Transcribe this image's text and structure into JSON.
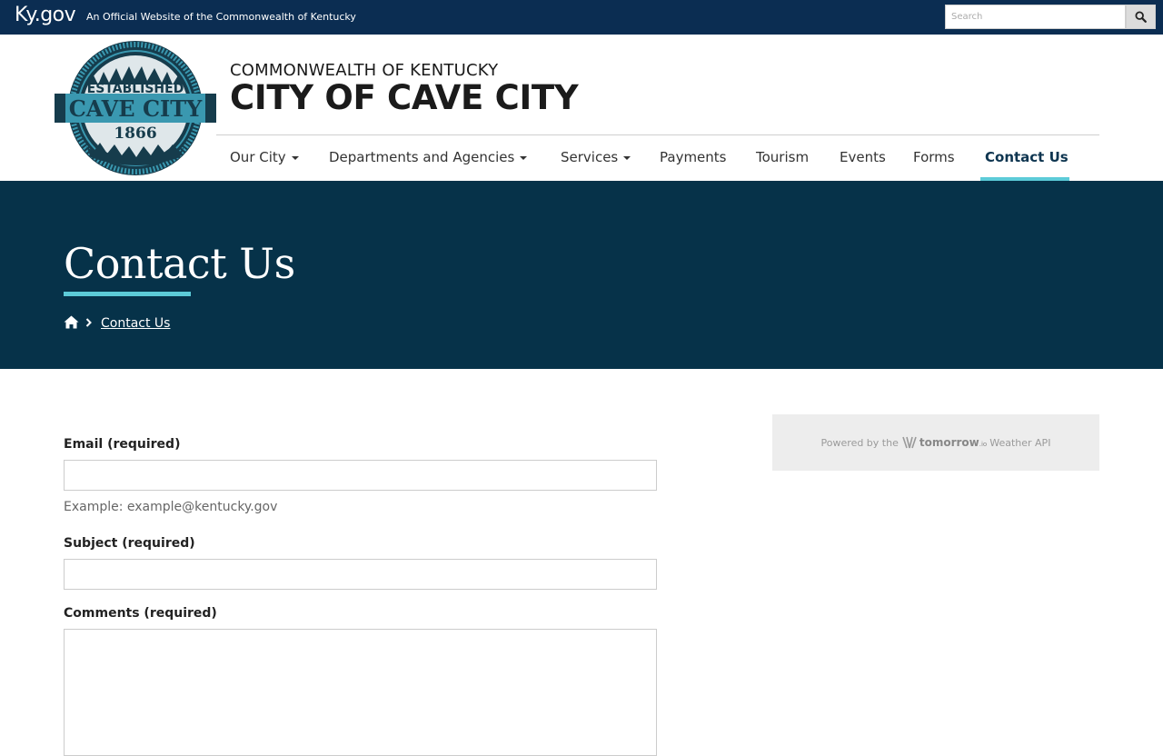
{
  "kygov": {
    "logo": "Ky.gov",
    "tagline": "An Official Website of the Commonwealth of Kentucky",
    "search_placeholder": "Search"
  },
  "header": {
    "kicker": "COMMONWEALTH OF KENTUCKY",
    "title": "CITY OF CAVE CITY",
    "seal": {
      "top": "ESTABLISHED",
      "middle": "CAVE CITY",
      "year": "1866"
    }
  },
  "nav": {
    "items": [
      {
        "label": "Our City",
        "dropdown": true
      },
      {
        "label": "Departments and Agencies",
        "dropdown": true
      },
      {
        "label": "Services",
        "dropdown": true
      },
      {
        "label": "Payments",
        "dropdown": false
      },
      {
        "label": "Tourism",
        "dropdown": false
      },
      {
        "label": "Events",
        "dropdown": false
      },
      {
        "label": "Forms",
        "dropdown": false
      },
      {
        "label": "Contact Us",
        "dropdown": false,
        "active": true
      }
    ]
  },
  "hero": {
    "title": "Contact Us",
    "breadcrumb": "Contact Us"
  },
  "form": {
    "email_label": "Email (required)",
    "email_hint": "Example: example@kentucky.gov",
    "subject_label": "Subject (required)",
    "comments_label": "Comments (required)"
  },
  "weather": {
    "prefix": "Powered by the",
    "brand": "tomorrow",
    "brand_suffix": ".io",
    "suffix": "Weather API"
  },
  "colors": {
    "kybar": "#0b2d52",
    "hero": "#063249",
    "accent": "#5ccbd8",
    "seal_dark": "#163c4c",
    "seal_teal": "#3a98b0"
  }
}
